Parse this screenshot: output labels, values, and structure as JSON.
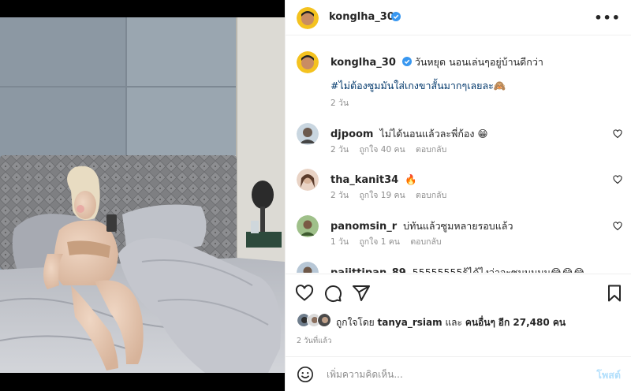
{
  "post": {
    "username": "konglha_30",
    "verified": true,
    "more_icon": "more-horizontal-icon",
    "caption": "วันหยุด นอนเล่นๆอยู่บ้านดีกว่า",
    "hashtag": "#ไม่ต้องซูมมันใส่เกงขาสั้นมากๆเลยละ🙈",
    "caption_time": "2 วัน"
  },
  "comments": [
    {
      "username": "djpoom",
      "text": "ไม่ได้นอนแล้วละพี่ก้อง 😁",
      "time": "2 วัน",
      "likes": "ถูกใจ 40 คน",
      "reply": "ตอบกลับ"
    },
    {
      "username": "tha_kanit34",
      "text": "🔥",
      "time": "2 วัน",
      "likes": "ถูกใจ 19 คน",
      "reply": "ตอบกลับ"
    },
    {
      "username": "panomsin_r",
      "text": "บ่ทันแล้วซูมหลายรอบแล้ว",
      "time": "1 วัน",
      "likes": "ถูกใจ 1 คน",
      "reply": "ตอบกลับ"
    },
    {
      "username": "paiittipan_89",
      "text": "55555555รู้ได้ไงว่าจะซูมมมมม😂😂😂",
      "time": "",
      "likes": "",
      "reply": ""
    }
  ],
  "actions": {
    "like_icon": "heart-icon",
    "comment_icon": "comment-icon",
    "share_icon": "share-icon",
    "save_icon": "bookmark-icon"
  },
  "likes": {
    "prefix": "ถูกใจโดย",
    "first_liker": "tanya_rsiam",
    "joiner": "และ",
    "others": "คนอื่นๆ",
    "others_count": "อีก 27,480 คน"
  },
  "date": "2 วันที่แล้ว",
  "composer": {
    "placeholder": "เพิ่มความคิดเห็น...",
    "post_label": "โพสต์",
    "emoji_icon": "emoji-icon"
  },
  "colors": {
    "link": "#00376b",
    "meta": "#8e8e8e",
    "verified": "#3897f0",
    "post_disabled": "#b2dffc"
  }
}
